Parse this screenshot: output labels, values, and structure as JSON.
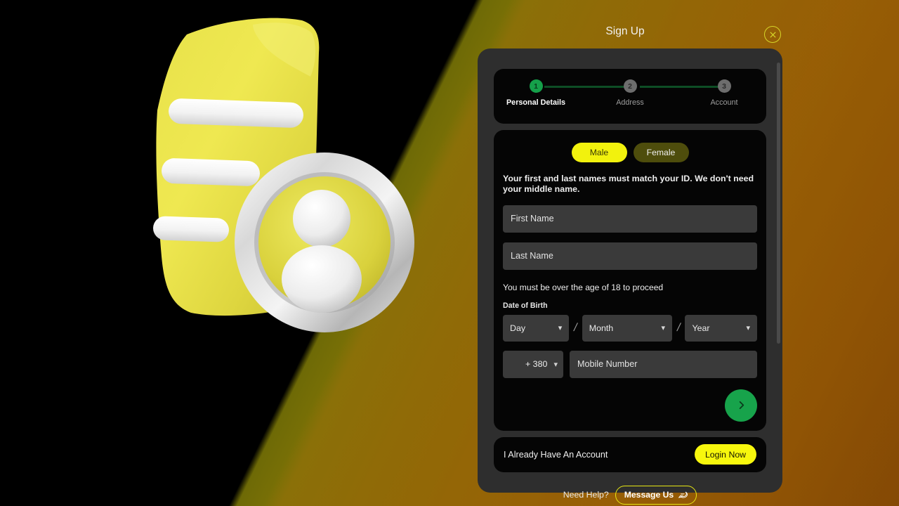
{
  "sheet": {
    "title": "Sign Up",
    "close_icon": "close-circle-icon"
  },
  "stepper": {
    "steps": [
      {
        "number": "1",
        "label": "Personal Details",
        "state": "active"
      },
      {
        "number": "2",
        "label": "Address",
        "state": "idle"
      },
      {
        "number": "3",
        "label": "Account",
        "state": "idle"
      }
    ]
  },
  "form": {
    "gender": {
      "male": "Male",
      "female": "Female",
      "selected": "Male"
    },
    "name_helper": "Your first and last names must match your ID. We don't need your middle name.",
    "first_name": {
      "placeholder": "First Name",
      "value": ""
    },
    "last_name": {
      "placeholder": "Last Name",
      "value": ""
    },
    "age_note": "You must be over the age of 18 to proceed",
    "dob_label": "Date of Birth",
    "dob": {
      "day": "Day",
      "month": "Month",
      "year": "Year",
      "separator": "/",
      "chevron_icon": "chevron-down-icon"
    },
    "phone": {
      "flag_icon": "ukraine-flag-icon",
      "country_code": "+ 380",
      "chevron_icon": "chevron-down-icon",
      "placeholder": "Mobile Number",
      "value": ""
    },
    "next_icon": "chevron-right-icon"
  },
  "account": {
    "text": "I Already Have An Account",
    "login_label": "Login Now"
  },
  "help": {
    "text": "Need Help?",
    "button_label": "Message Us",
    "icon": "chat-bubble-icon"
  },
  "colors": {
    "accent_yellow": "#f7f70d",
    "accent_yellow_dim": "#4e4d0c",
    "success_green": "#17a34b",
    "step_line": "#0d4d25",
    "panel_bg": "#2e2e2e",
    "card_bg": "#050505",
    "field_bg": "#3a3a3a"
  }
}
